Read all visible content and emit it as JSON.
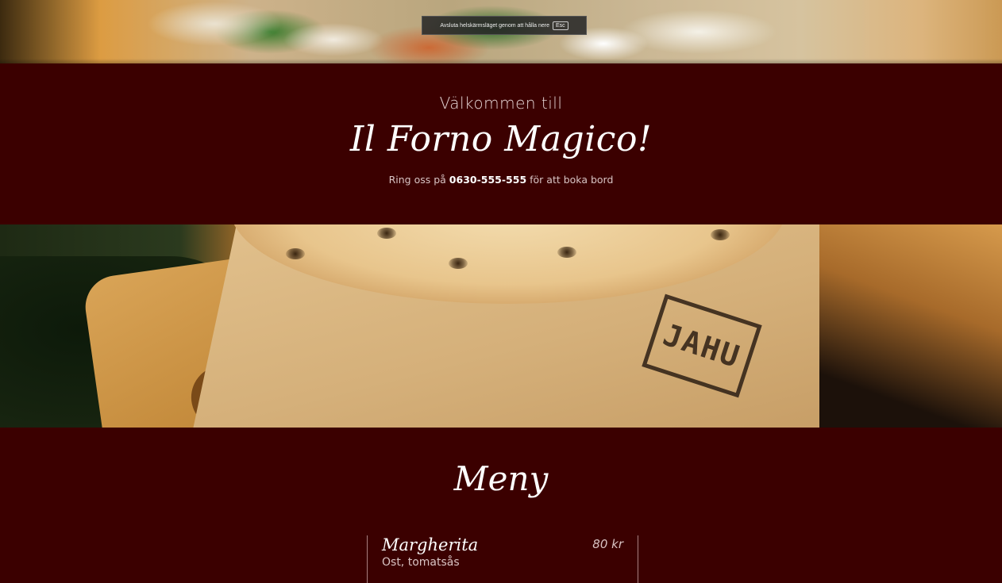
{
  "fullscreen_notice": {
    "text": "Avsluta helskärmsläget genom att hålla nere",
    "key": "Esc"
  },
  "hero": {
    "welcome": "Välkommen till",
    "title": "Il Forno Magico!",
    "call_prefix": "Ring oss på ",
    "phone": "0630-555-555",
    "call_suffix": " för att boka bord"
  },
  "photo": {
    "stamp_text": "JAHU"
  },
  "menu": {
    "title": "Meny",
    "items": [
      {
        "name": "Margherita",
        "price": "80 kr",
        "description": "Ost, tomatsås"
      }
    ]
  },
  "colors": {
    "background": "#3b0000",
    "text_primary": "#ffffff",
    "text_secondary": "#d9c4c4"
  }
}
